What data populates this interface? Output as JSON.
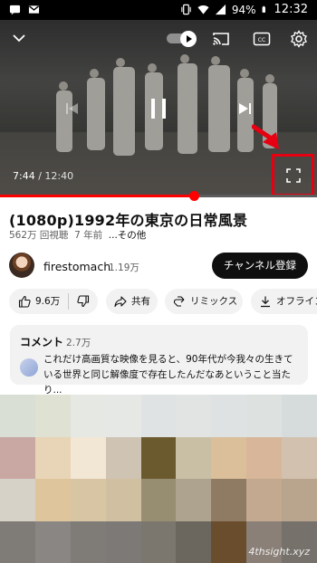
{
  "statusbar": {
    "battery": "94%",
    "time": "12:32"
  },
  "player": {
    "current_time": "7:44",
    "duration": "12:40",
    "progress_fraction": 0.61,
    "icons": [
      "chevron-down-icon",
      "autoplay-toggle-icon",
      "cast-icon",
      "captions-icon",
      "settings-icon",
      "previous-icon",
      "pause-icon",
      "next-icon",
      "fullscreen-icon"
    ]
  },
  "video": {
    "title": "(1080p)1992年の東京の日常風景",
    "views": "562万 回視聴",
    "age": "7 年前",
    "more": "...その他"
  },
  "channel": {
    "name": "firestomach",
    "subscribers": "1.19万",
    "subscribe_label": "チャンネル登録"
  },
  "actions": {
    "likes": "9.6万",
    "share": "共有",
    "remix": "リミックス",
    "offline": "オフライン"
  },
  "comments": {
    "heading": "コメント",
    "count": "2.7万",
    "top_comment": "これだけ高画質な映像を見ると、90年代が今我々の生きている世界と同じ解像度で存在したんだなあということ当たり..."
  },
  "watermark": "4thsight.xyz",
  "colors": {
    "accent": "#ff0000",
    "highlight_box": "#e60012",
    "mosaic": [
      "#d9dfd4",
      "#dfe1d3",
      "#e6e8e3",
      "#e6e8e6",
      "#dfe3e4",
      "#e2e3e3",
      "#dfe2e2",
      "#dde2e0",
      "#d6dcdc",
      "#c9a7a2",
      "#e8d4b6",
      "#f2e6d5",
      "#cfc4b4",
      "#6a5a2e",
      "#c8bfa4",
      "#dbbf9a",
      "#d8b69a",
      "#d2c1ae",
      "#d6d2c7",
      "#dec59b",
      "#d8c5a4",
      "#d1bfa2",
      "#978e72",
      "#ada38f",
      "#8f7b64",
      "#c2a98f",
      "#b9a48e",
      "#7f7b76",
      "#8a8683",
      "#7f7b77",
      "#7c7976",
      "#7c776e",
      "#6b675f",
      "#6a4d2c",
      "#8a8077",
      "#76726b"
    ]
  }
}
